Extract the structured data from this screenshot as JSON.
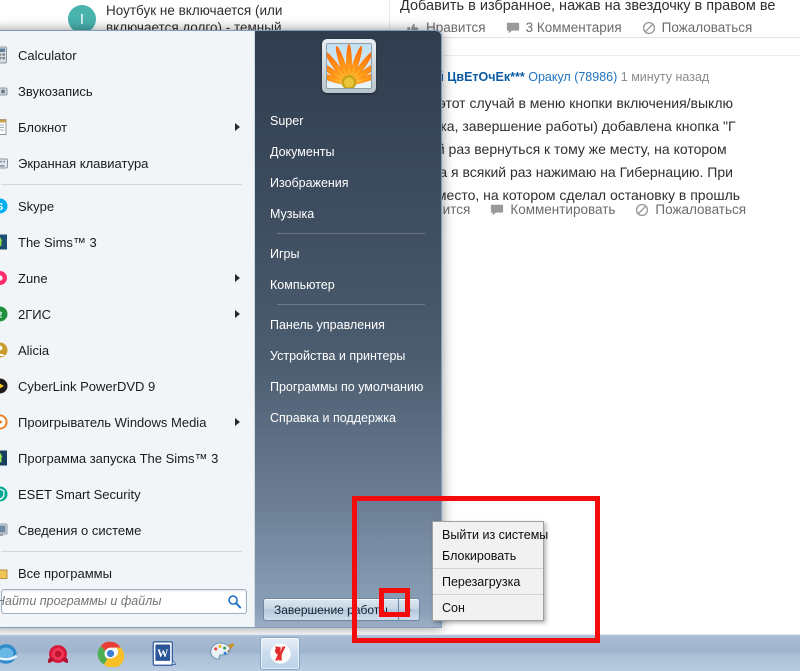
{
  "browser_page": {
    "question_card": {
      "avatar_letter": "I",
      "title": "Ноутбук не включается (или включается долго) - темный"
    },
    "article_line": "Добавить в избранное, нажав на звездочку в правом ве",
    "top_actions": [
      {
        "icon": "thumbs-up-icon",
        "label": "Нравится"
      },
      {
        "icon": "comment-icon",
        "label": "3 Комментария"
      },
      {
        "icon": "report-icon",
        "label": "Пожаловаться"
      }
    ],
    "comment": {
      "author": "енький ЦвЕтОчЕк***",
      "rank": "Оракул (78986)",
      "time": "1 минуту назад",
      "lines": [
        "ня на этот случай в меню кнопки включения/выклю",
        "загрузка, завершение работы) добавлена кнопка \"Г",
        "ующий раз вернуться к тому же месту, на котором",
        "ьютера я всякий раз нажимаю на Гибернацию. При",
        "имое место, на котором сделал остановку в прошль"
      ],
      "actions": [
        {
          "icon": "thumbs-up-icon",
          "label": "авится"
        },
        {
          "icon": "comment-icon",
          "label": "Комментировать"
        },
        {
          "icon": "report-icon",
          "label": "Пожаловаться"
        }
      ]
    }
  },
  "start_menu": {
    "programs": [
      {
        "label": "Calculator",
        "icon": "calculator-icon",
        "submenu": false,
        "separator_after": false
      },
      {
        "label": "Звукозапись",
        "icon": "soundrec-icon",
        "submenu": false,
        "separator_after": false
      },
      {
        "label": "Блокнот",
        "icon": "notepad-icon",
        "submenu": true,
        "separator_after": false
      },
      {
        "label": "Экранная клавиатура",
        "icon": "keyboard-icon",
        "submenu": false,
        "separator_after": true
      },
      {
        "label": "Skype",
        "icon": "skype-icon",
        "submenu": false,
        "separator_after": false
      },
      {
        "label": "The Sims™ 3",
        "icon": "sims-icon",
        "submenu": false,
        "separator_after": false
      },
      {
        "label": "Zune",
        "icon": "zune-icon",
        "submenu": true,
        "separator_after": false
      },
      {
        "label": "2ГИС",
        "icon": "2gis-icon",
        "submenu": true,
        "separator_after": false
      },
      {
        "label": "Alicia",
        "icon": "alicia-icon",
        "submenu": false,
        "separator_after": false
      },
      {
        "label": "CyberLink PowerDVD 9",
        "icon": "powerdvd-icon",
        "submenu": false,
        "separator_after": false
      },
      {
        "label": "Проигрыватель Windows Media",
        "icon": "wmp-icon",
        "submenu": true,
        "separator_after": false
      },
      {
        "label": "Программа запуска The Sims™ 3",
        "icon": "sims-launch-icon",
        "submenu": false,
        "separator_after": false
      },
      {
        "label": "ESET Smart Security",
        "icon": "eset-icon",
        "submenu": false,
        "separator_after": false
      },
      {
        "label": "Сведения о системе",
        "icon": "sysinfo-icon",
        "submenu": false,
        "separator_after": true
      },
      {
        "label": "Все программы",
        "icon": "allprograms-icon",
        "submenu": false,
        "separator_after": false
      }
    ],
    "search": {
      "placeholder": "Найти программы и файлы",
      "value": "",
      "icon": "search-icon"
    },
    "user_picture": "flower-avatar",
    "right_items": [
      {
        "label": "Super",
        "separator_after": false
      },
      {
        "label": "Документы",
        "separator_after": false
      },
      {
        "label": "Изображения",
        "separator_after": false
      },
      {
        "label": "Музыка",
        "separator_after": true
      },
      {
        "label": "Игры",
        "separator_after": false
      },
      {
        "label": "Компьютер",
        "separator_after": true
      },
      {
        "label": "Панель управления",
        "separator_after": false
      },
      {
        "label": "Устройства и принтеры",
        "separator_after": false
      },
      {
        "label": "Программы по умолчанию",
        "separator_after": false
      },
      {
        "label": "Справка и поддержка",
        "separator_after": false
      }
    ],
    "shutdown": {
      "label": "Завершение работы",
      "arrow_icon": "chevron-right-icon"
    }
  },
  "shutdown_flyout": {
    "groups": [
      [
        "Выйти из системы",
        "Блокировать"
      ],
      [
        "Перезагрузка"
      ],
      [
        "Сон"
      ]
    ]
  },
  "taskbar": {
    "icons": [
      {
        "name": "ie-icon",
        "active": false
      },
      {
        "name": "rose-icon",
        "active": false
      },
      {
        "name": "chrome-icon",
        "active": false
      },
      {
        "name": "word-icon",
        "active": false
      },
      {
        "name": "paint-icon",
        "active": false
      },
      {
        "name": "yandex-icon",
        "active": true
      }
    ]
  },
  "annotations": {
    "highlight_color": "#f40b0b",
    "boxes": [
      "shutdown-flyout-region",
      "shutdown-arrow-button"
    ]
  }
}
